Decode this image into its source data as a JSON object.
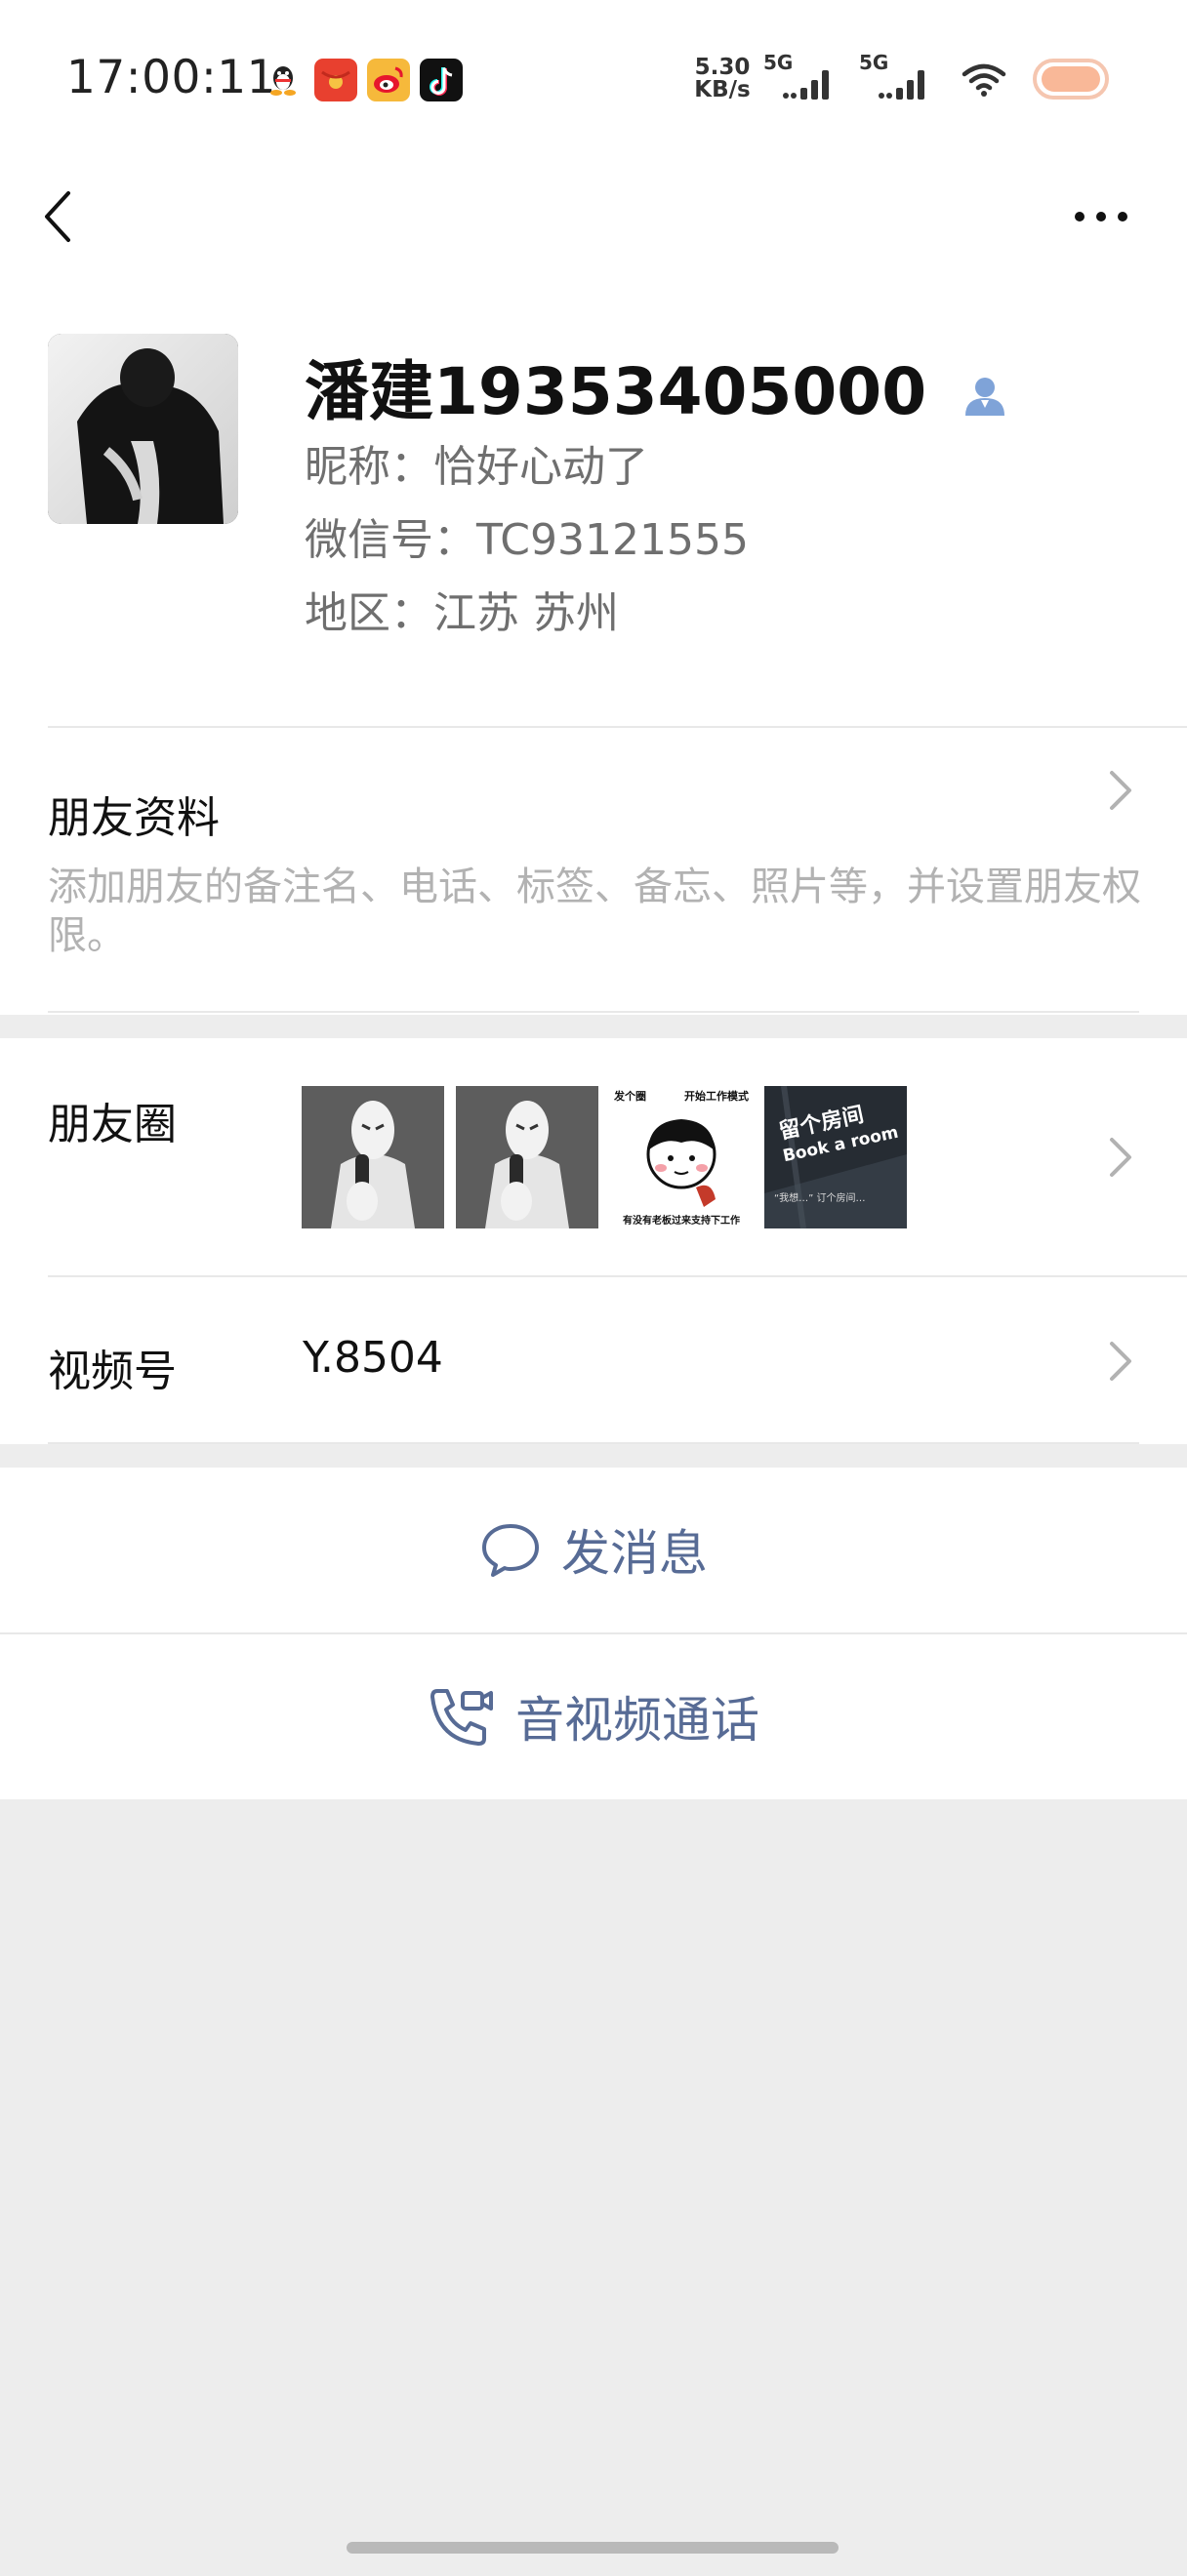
{
  "status_bar": {
    "time": "17:00:11",
    "net_speed_value": "5.30",
    "net_speed_unit": "KB/s",
    "signal_1_label": "5G",
    "signal_2_label": "5G",
    "app_icons": [
      "qq-icon",
      "red-envelope-icon",
      "weibo-icon",
      "douyin-icon"
    ]
  },
  "header": {
    "back_icon": "chevron-left-icon",
    "more_icon": "more-dots-icon"
  },
  "profile": {
    "name": "潘建19353405000",
    "nickname": "昵称：恰好心动了",
    "wechat_id": "微信号：TC93121555",
    "region": "地区：江苏  苏州"
  },
  "friend_info": {
    "title": "朋友资料",
    "description": "添加朋友的备注名、电话、标签、备忘、照片等，并设置朋友权限。"
  },
  "moments": {
    "label": "朋友圈",
    "thumbs": [
      {
        "name": "moments-photo-1"
      },
      {
        "name": "moments-photo-2"
      },
      {
        "name": "moments-photo-3",
        "caption_top_left": "发个圈",
        "caption_top_right": "开始工作模式",
        "caption_bottom": "有没有老板过来支持下工作"
      },
      {
        "name": "moments-photo-4",
        "caption": "留个房间",
        "caption_en": "Book a room",
        "caption_small": "“我想…”  订个房间…"
      }
    ]
  },
  "channels": {
    "label": "视频号",
    "value": "Y.8504"
  },
  "actions": {
    "message": "发消息",
    "call": "音视频通话"
  },
  "colors": {
    "link": "#576b95",
    "background": "#ededed",
    "surface": "#ffffff",
    "muted": "#b2b2b2",
    "secondary": "#6f6f6f"
  }
}
